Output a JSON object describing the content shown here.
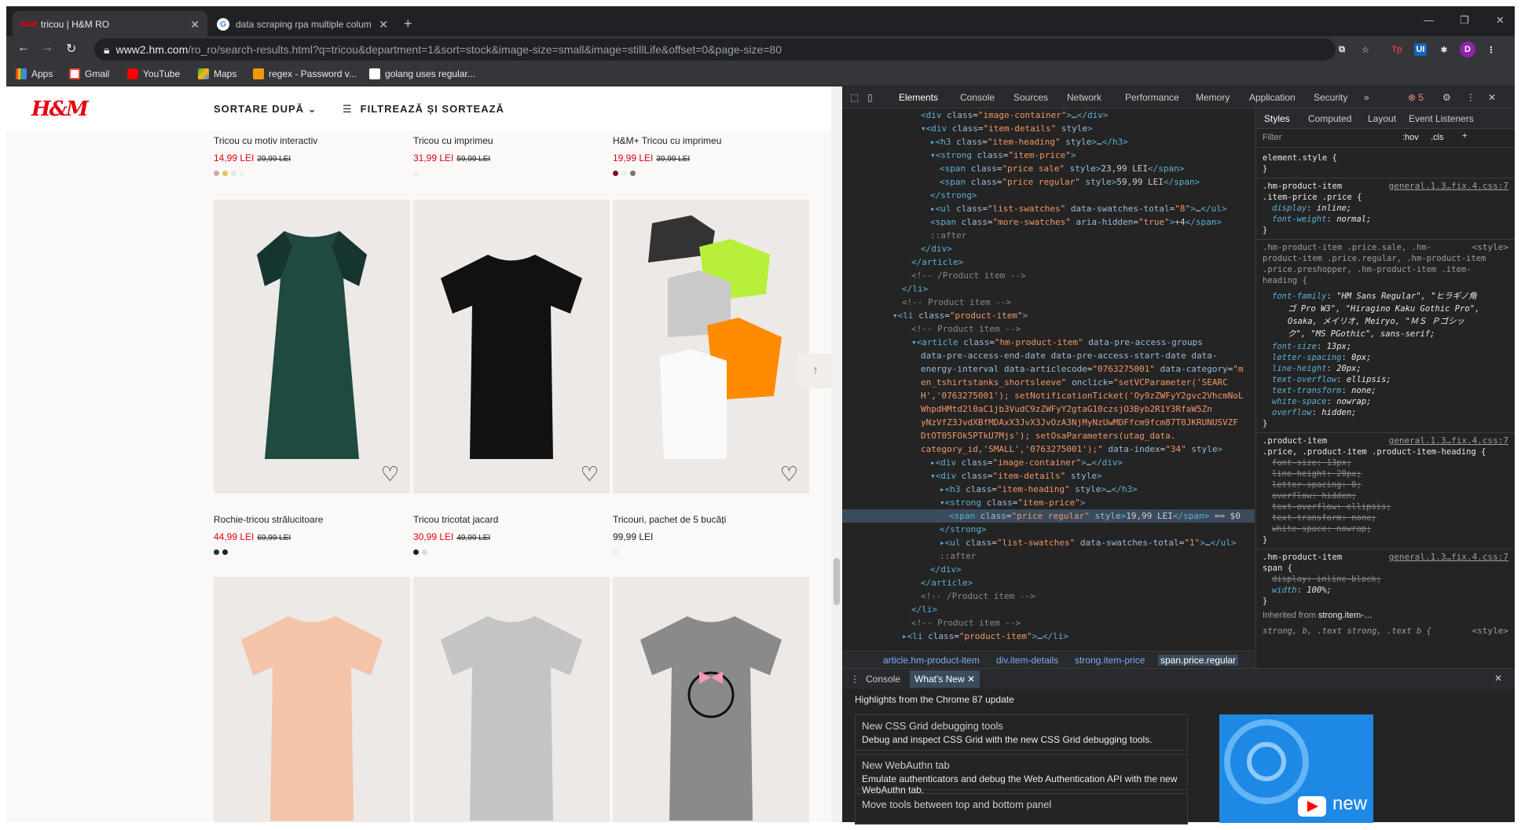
{
  "browser": {
    "tabs": [
      {
        "title": "tricou | H&M RO",
        "favicon": "hm-icon"
      },
      {
        "title": "data scraping rpa multiple colum",
        "favicon": "google-icon"
      }
    ],
    "url_host": "www2.hm.com",
    "url_path": "/ro_ro/search-results.html?q=tricou&department=1&sort=stock&image-size=small&image=stillLife&offset=0&page-size=80",
    "profile_initial": "D",
    "bookmarks": [
      "Apps",
      "Gmail",
      "YouTube",
      "Maps",
      "regex - Password v...",
      "golang uses regular..."
    ]
  },
  "page": {
    "logo": "H&M",
    "sort_label": "SORTARE DUPĂ",
    "filter_label": "FILTREAZĂ ȘI SORTEAZĂ",
    "products_row1": [
      {
        "name": "Tricou cu motiv interactiv",
        "price": "14,99 LEI",
        "old_price": "29,99 LEI",
        "swatches": [
          "#d7a3b0",
          "#e6c25a",
          "#e8e8e8",
          "#eeeeee"
        ]
      },
      {
        "name": "Tricou cu imprimeu",
        "price": "31,99 LEI",
        "old_price": "59,99 LEI",
        "swatches": [
          "#eeeeee"
        ]
      },
      {
        "name": "H&M+ Tricou cu imprimeu",
        "price": "19,99 LEI",
        "old_price": "39,99 LEI",
        "swatches": [
          "#7a1020",
          "#eeeeee",
          "#777777"
        ]
      }
    ],
    "products_row2": [
      {
        "name": "Rochie-tricou strălucitoare",
        "price": "44,99 LEI",
        "old_price": "69,99 LEI",
        "swatches": [
          "#1f3b35",
          "#222222"
        ],
        "image": "dark-green-sequin-dress"
      },
      {
        "name": "Tricou tricotat jacard",
        "price": "30,99 LEI",
        "old_price": "49,99 LEI",
        "swatches": [
          "#222222",
          "#dddddd"
        ],
        "image": "black-tshirt"
      },
      {
        "name": "Tricouri, pachet de 5 bucăți",
        "price": "99,99 LEI",
        "old_price": "",
        "swatches": [
          "#eeeeee"
        ],
        "image": "5-pack-tshirts"
      }
    ],
    "products_row3_images": [
      "peach-tshirt",
      "grey-tshirt",
      "minnie-grey-tshirt"
    ]
  },
  "devtools": {
    "tabs": [
      "Elements",
      "Console",
      "Sources",
      "Network",
      "Performance",
      "Memory",
      "Application",
      "Security"
    ],
    "error_count": "5",
    "style_tabs": [
      "Styles",
      "Computed",
      "Layout",
      "Event Listeners"
    ],
    "filter_placeholder": "Filter",
    "hov": ":hov",
    "cls": ".cls",
    "breadcrumbs": [
      "article.hm-product-item",
      "div.item-details",
      "strong.item-price",
      "span.price.regular"
    ],
    "drawer_tabs": [
      "Console",
      "What's New"
    ],
    "drawer_heading": "Highlights from the Chrome 87 update",
    "cards": [
      {
        "title": "New CSS Grid debugging tools",
        "desc": "Debug and inspect CSS Grid with the new CSS Grid debugging tools."
      },
      {
        "title": "New WebAuthn tab",
        "desc": "Emulate authenticators and debug the Web Authentication API with the new WebAuthn tab."
      },
      {
        "title": "Move tools between top and bottom panel",
        "desc": ""
      }
    ],
    "thumb_text": "new"
  }
}
